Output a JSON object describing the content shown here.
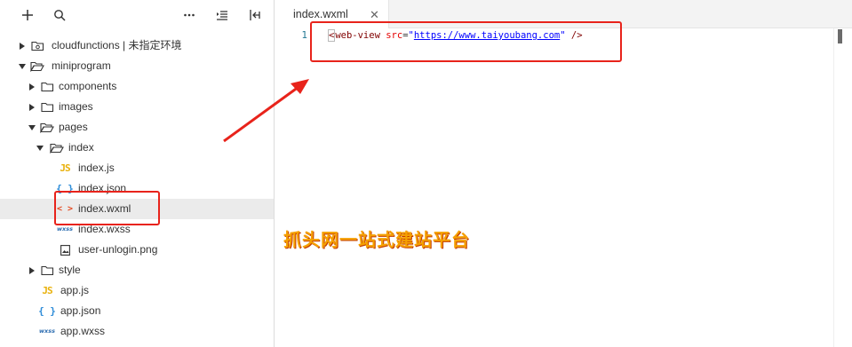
{
  "toolbar": {
    "icons": [
      "add-icon",
      "search-icon",
      "more-icon",
      "outline-icon",
      "collapse-icon"
    ]
  },
  "tree": [
    {
      "label": "cloudfunctions | 未指定环境",
      "icon": "folder-cloud-icon",
      "expanded": false
    },
    {
      "label": "miniprogram",
      "icon": "folder-open-icon",
      "expanded": true
    },
    {
      "label": "components",
      "icon": "folder-icon",
      "expanded": false
    },
    {
      "label": "images",
      "icon": "folder-icon",
      "expanded": false
    },
    {
      "label": "pages",
      "icon": "folder-open-icon",
      "expanded": true
    },
    {
      "label": "index",
      "icon": "folder-open-icon",
      "expanded": true
    },
    {
      "label": "index.js",
      "icon": "js-icon",
      "icon_text": "JS"
    },
    {
      "label": "index.json",
      "icon": "json-icon",
      "icon_text": "{ }"
    },
    {
      "label": "index.wxml",
      "icon": "wxml-icon",
      "icon_text": "< >",
      "selected": true
    },
    {
      "label": "index.wxss",
      "icon": "wxss-icon",
      "icon_text": "wxss"
    },
    {
      "label": "user-unlogin.png",
      "icon": "image-icon"
    },
    {
      "label": "style",
      "icon": "folder-icon",
      "expanded": false
    },
    {
      "label": "app.js",
      "icon": "js-icon",
      "icon_text": "JS"
    },
    {
      "label": "app.json",
      "icon": "json-icon",
      "icon_text": "{ }"
    },
    {
      "label": "app.wxss",
      "icon": "wxss-icon",
      "icon_text": "wxss"
    }
  ],
  "editor": {
    "tab_label": "index.wxml",
    "tab_close": "✕",
    "line_number": "1",
    "code": {
      "open": "<",
      "tag": "web-view",
      "attr": "src",
      "eq": "=",
      "quote_open": "\"",
      "url": "https://www.taiyoubang.com",
      "quote_close": "\"",
      "close": " />"
    }
  },
  "annotation": {
    "caption": "抓头网一站式建站平台"
  },
  "colors": {
    "annotation_red": "#e8231b",
    "caption_orange": "#f5a000",
    "selected_row": "#ebebeb"
  }
}
